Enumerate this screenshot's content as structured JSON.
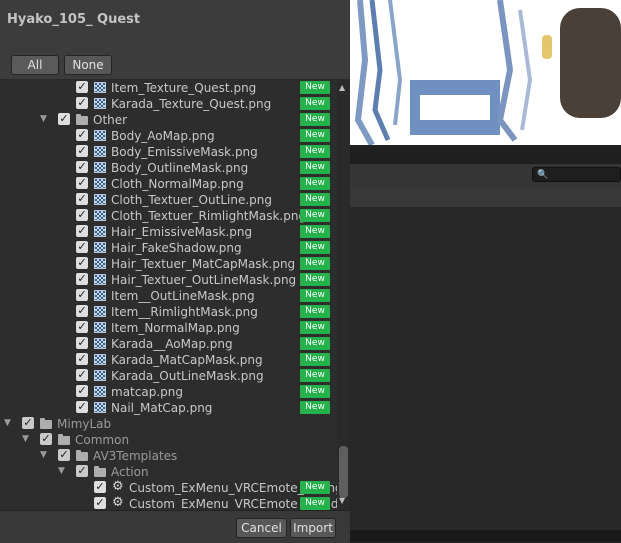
{
  "dialog": {
    "title": "Hyako_105_ Quest",
    "all_label": "All",
    "none_label": "None",
    "cancel_label": "Cancel",
    "import_label": "Import"
  },
  "tree_items": [
    {
      "label": "Item_Texture_Quest.png",
      "icon": "texture-icon",
      "depth": 3,
      "new": "New"
    },
    {
      "label": "Karada_Texture_Quest.png",
      "icon": "texture-icon",
      "depth": 3,
      "new": "New"
    },
    {
      "label": "Other",
      "icon": "folder-icon",
      "depth": 2,
      "new": "New",
      "folder": true
    },
    {
      "label": "Body_AoMap.png",
      "icon": "texture-icon",
      "depth": 3,
      "new": "New"
    },
    {
      "label": "Body_EmissiveMask.png",
      "icon": "texture-icon",
      "depth": 3,
      "new": "New"
    },
    {
      "label": "Body_OutlineMask.png",
      "icon": "texture-icon",
      "depth": 3,
      "new": "New"
    },
    {
      "label": "Cloth_NormalMap.png",
      "icon": "texture-icon",
      "depth": 3,
      "new": "New"
    },
    {
      "label": "Cloth_Textuer_OutLine.png",
      "icon": "texture-icon",
      "depth": 3,
      "new": "New"
    },
    {
      "label": "Cloth_Textuer_RimlightMask.png",
      "icon": "texture-icon",
      "depth": 3,
      "new": "New"
    },
    {
      "label": "Hair_EmissiveMask.png",
      "icon": "texture-icon",
      "depth": 3,
      "new": "New"
    },
    {
      "label": "Hair_FakeShadow.png",
      "icon": "texture-icon",
      "depth": 3,
      "new": "New"
    },
    {
      "label": "Hair_Textuer_MatCapMask.png",
      "icon": "texture-icon",
      "depth": 3,
      "new": "New"
    },
    {
      "label": "Hair_Textuer_OutLineMask.png",
      "icon": "texture-icon",
      "depth": 3,
      "new": "New"
    },
    {
      "label": "Item__OutLineMask.png",
      "icon": "texture-icon",
      "depth": 3,
      "new": "New"
    },
    {
      "label": "Item__RimlightMask.png",
      "icon": "texture-icon",
      "depth": 3,
      "new": "New"
    },
    {
      "label": "Item_NormalMap.png",
      "icon": "texture-icon",
      "depth": 3,
      "new": "New"
    },
    {
      "label": "Karada__AoMap.png",
      "icon": "texture-icon",
      "depth": 3,
      "new": "New"
    },
    {
      "label": "Karada_MatCapMask.png",
      "icon": "texture-icon",
      "depth": 3,
      "new": "New"
    },
    {
      "label": "Karada_OutLineMask.png",
      "icon": "texture-icon",
      "depth": 3,
      "new": "New"
    },
    {
      "label": "matcap.png",
      "icon": "texture-icon",
      "depth": 3,
      "new": "New"
    },
    {
      "label": "Nail_MatCap.png",
      "icon": "texture-icon",
      "depth": 3,
      "new": "New"
    },
    {
      "label": "MimyLab",
      "icon": "folder-icon",
      "depth": 0,
      "new": "",
      "folder": true,
      "dim": true
    },
    {
      "label": "Common",
      "icon": "folder-icon",
      "depth": 1,
      "new": "",
      "folder": true,
      "dim": true
    },
    {
      "label": "AV3Templates",
      "icon": "folder-icon",
      "depth": 2,
      "new": "",
      "folder": true,
      "dim": true
    },
    {
      "label": "Action",
      "icon": "folder-icon",
      "depth": 3,
      "new": "",
      "folder": true,
      "dim": true
    },
    {
      "label": "Custom_ExMenu_VRCEmote_Sitting",
      "icon": "gear-icon",
      "depth": 4,
      "new": "New"
    },
    {
      "label": "Custom_ExMenu_VRCEmote_Standing",
      "icon": "gear-icon",
      "depth": 4,
      "new": "New"
    }
  ],
  "scene": {
    "search_placeholder": "🔍"
  },
  "colors": {
    "new_badge": "#25b24a",
    "dialog_bg": "#383838",
    "tree_bg": "#2d2d2d"
  }
}
